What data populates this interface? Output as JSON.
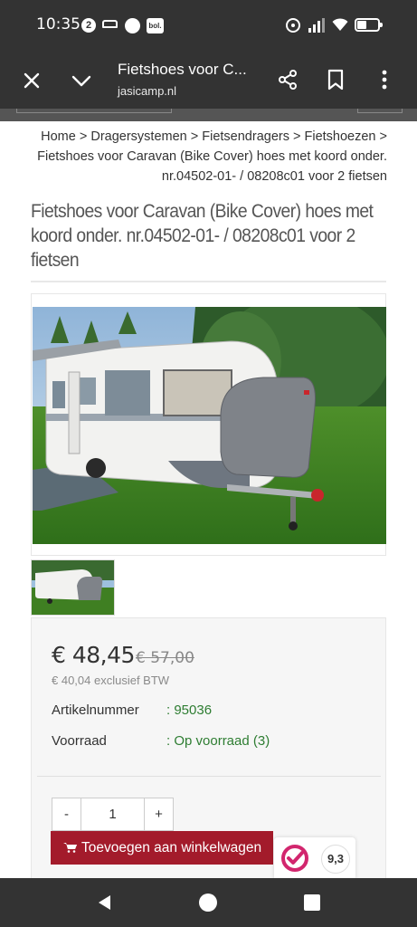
{
  "status_bar": {
    "time": "10:35",
    "notification_badge": "2",
    "bol_label": "bol."
  },
  "browser": {
    "title": "Fietshoes voor C...",
    "url": "jasicamp.nl"
  },
  "breadcrumb": {
    "items": [
      "Home",
      "Dragersystemen",
      "Fietsendragers",
      "Fietshoezen",
      "Fietshoes voor Caravan (Bike Cover) hoes met koord onder. nr.04502-01- / 08208c01 voor 2 fietsen"
    ],
    "separator": ">"
  },
  "product": {
    "title": "Fietshoes voor Caravan (Bike Cover) hoes met koord onder. nr.04502-01- / 08208c01 voor 2 fietsen",
    "price": "€ 48,45",
    "old_price": "€ 57,00",
    "price_ex_vat": "€ 40,04 exclusief BTW",
    "specs": [
      {
        "label": "Artikelnummer",
        "value": ": 95036"
      },
      {
        "label": "Voorraad",
        "value": ": Op voorraad (3)"
      }
    ],
    "quantity": "1",
    "qty_minus": "-",
    "qty_plus": "+",
    "add_to_cart": "Toevoegen aan winkelwagen"
  },
  "rating": {
    "score": "9,3"
  },
  "colors": {
    "accent": "#a31b2b",
    "stock_green": "#2e7d32",
    "chrome_dark": "#333333"
  }
}
